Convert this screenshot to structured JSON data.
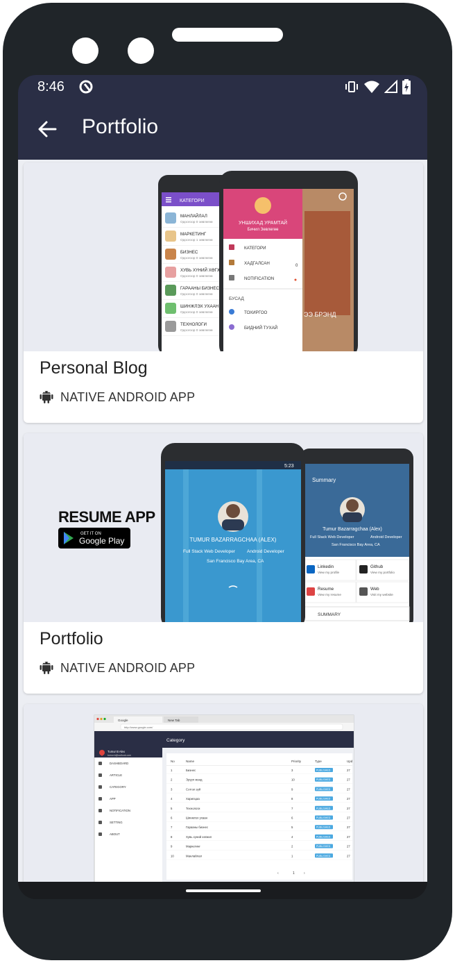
{
  "status": {
    "time": "8:46"
  },
  "appbar": {
    "title": "Portfolio"
  },
  "cards": [
    {
      "title": "Personal Blog",
      "subtitle": "NATIVE ANDROID APP",
      "preview": {
        "left_header": "КАТЕГОРИ",
        "left_items": [
          {
            "name": "МАНЛАЙЛАЛ",
            "sub": "Одоогоор 0 зөвлөгөө"
          },
          {
            "name": "МАРКЕТИНГ",
            "sub": "Одоогоор 1 зөвлөгөө"
          },
          {
            "name": "БИЗНЕС",
            "sub": "Одоогоор 0 зөвлөгөө"
          },
          {
            "name": "ХУВЬ ХҮНИЙ ХӨГЖ",
            "sub": "Одоогоор 0 зөвлөгөө"
          },
          {
            "name": "ГАРААНЫ БИЗНЕС",
            "sub": "Одоогоор 0 зөвлөгөө"
          },
          {
            "name": "ШИНЖЛЭХ УХААН",
            "sub": "Одоогоор 0 зөвлөгөө"
          },
          {
            "name": "ТЕХНОЛОГИ",
            "sub": "Одоогоор 0 зөвлөгөө"
          }
        ],
        "drawer_title": "УНШИХАД УРАМТАЙ",
        "drawer_sub": "Бичил Зөвлөгөө",
        "drawer_items": [
          "КАТЕГОРИ",
          "ХАДГАЛСАН",
          "NOTIFICATION"
        ],
        "drawer_badge": "0",
        "drawer_section": "БУСАД",
        "drawer_items2": [
          "ТОХИРГОО",
          "БИДНИЙ ТУХАЙ"
        ],
        "bg_text": "ЭЭ БРЭНД"
      }
    },
    {
      "title": "Portfolio",
      "subtitle": "NATIVE ANDROID APP",
      "preview": {
        "brand": "RESUME APP",
        "badge_top": "GET IT ON",
        "badge_main": "Google Play",
        "clock": "5:23",
        "name_main": "TUMUR BAZARRAGCHAA (ALEX)",
        "role1": "Full Stack Web Developer",
        "role2": "Android Developer",
        "location": "San Francisco Bay Area, CA",
        "summary_header": "Summary",
        "name_alt": "Tumur Bazarragchaa (Alex)",
        "links": [
          {
            "name": "Linkedin",
            "sub": "View my profile"
          },
          {
            "name": "Github",
            "sub": "View my portfolio"
          },
          {
            "name": "Resume",
            "sub": "View my resume"
          },
          {
            "name": "Web",
            "sub": "Visit my website"
          }
        ],
        "summary_label": "SUMMARY"
      }
    },
    {
      "title": "",
      "subtitle": "",
      "preview": {
        "tab1": "Google",
        "tab2": "New Tab",
        "url": "http://www.google.com/",
        "page_title": "Category",
        "user_name": "Tumur B Alex",
        "user_email": "tumur.b@outlook.com",
        "menu": [
          "DASHBOARD",
          "ARTICLE",
          "CATEGORY",
          "APP",
          "NOTIFICATION",
          "SETTING",
          "ABOUT"
        ],
        "columns": [
          "No",
          "Name",
          "Priority",
          "Type",
          "Upd"
        ],
        "rows": [
          [
            "1",
            "Бизнес",
            "3",
            "PUBLISHED",
            "27"
          ],
          [
            "2",
            "Эрүүл мэнд",
            "10",
            "PUBLISHED",
            "27"
          ],
          [
            "3",
            "Сэтгэл зүй",
            "9",
            "PUBLISHED",
            "27"
          ],
          [
            "4",
            "Харилцаа",
            "8",
            "PUBLISHED",
            "27"
          ],
          [
            "5",
            "Технологи",
            "7",
            "PUBLISHED",
            "27"
          ],
          [
            "6",
            "Шинжлэх ухаан",
            "6",
            "PUBLISHED",
            "27"
          ],
          [
            "7",
            "Гарааны бизнес",
            "5",
            "PUBLISHED",
            "27"
          ],
          [
            "8",
            "Хувь хүний хөгжил",
            "4",
            "PUBLISHED",
            "27"
          ],
          [
            "9",
            "Маркетинг",
            "2",
            "PUBLISHED",
            "27"
          ],
          [
            "10",
            "Манлайлал",
            "1",
            "PUBLISHED",
            "27"
          ]
        ],
        "pager": "1"
      }
    }
  ],
  "colors": {
    "appbar": "#2a2e45",
    "page_bg": "#eceef3",
    "card_bg": "#ffffff",
    "phone_frame": "#202529",
    "drawer_pink": "#d9467a",
    "left_header": "#7b4fc9",
    "sky_blue": "#3a98cf",
    "published_badge": "#4aa8e0"
  },
  "icons": {
    "android": "android-robot-icon",
    "back": "arrow-back-icon"
  }
}
